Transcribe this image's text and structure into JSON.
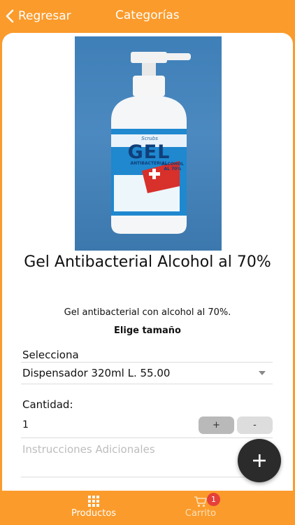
{
  "header": {
    "back_label": "Regresar",
    "title": "Categorías"
  },
  "product": {
    "image_label": "GEL",
    "image_sublabel": "ANTIBACTERIAL",
    "image_badge": "ALCOHOL AL 70%",
    "image_brand": "Scrubs",
    "title": "Gel Antibacterial Alcohol al 70%",
    "description": "Gel antibacterial con alcohol al 70%.",
    "size_heading": "Elige tamaño"
  },
  "form": {
    "select_label": "Selecciona",
    "size_value": "Dispensador 320ml L. 55.00",
    "quantity_label": "Cantidad:",
    "quantity_value": "1",
    "plus_label": "+",
    "minus_label": "-",
    "instructions_placeholder": "Instrucciones Adicionales"
  },
  "tabs": {
    "productos_label": "Productos",
    "carrito_label": "Carrito",
    "cart_badge": "1"
  },
  "colors": {
    "brand_orange": "#fb9b2b",
    "fab": "#2b2b2b",
    "badge": "#e5403a"
  },
  "icons": {
    "back": "chevron-left-icon",
    "fab": "plus-icon",
    "productos": "grid-icon",
    "carrito": "cart-icon"
  }
}
